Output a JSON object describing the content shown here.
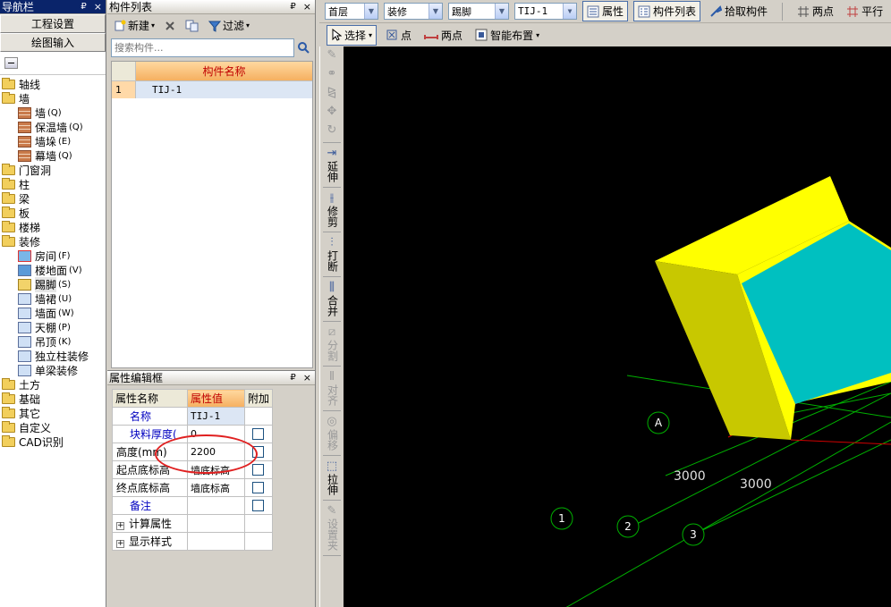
{
  "nav": {
    "title": "导航栏",
    "pin": "₽",
    "close": "×",
    "buttons": [
      "工程设置",
      "绘图输入"
    ],
    "tree": [
      {
        "label": "轴线",
        "level": 0
      },
      {
        "label": "墙",
        "level": 0
      },
      {
        "label": "墙",
        "key": "(Q)",
        "level": 1,
        "icon": "wall-icon"
      },
      {
        "label": "保温墙",
        "key": "(Q)",
        "level": 1,
        "icon": "insulation-wall-icon"
      },
      {
        "label": "墙垛",
        "key": "(E)",
        "level": 1,
        "icon": "wall-pier-icon"
      },
      {
        "label": "幕墙",
        "key": "(Q)",
        "level": 1,
        "icon": "curtain-wall-icon"
      },
      {
        "label": "门窗洞",
        "level": 0
      },
      {
        "label": "柱",
        "level": 0
      },
      {
        "label": "梁",
        "level": 0
      },
      {
        "label": "板",
        "level": 0
      },
      {
        "label": "楼梯",
        "level": 0
      },
      {
        "label": "装修",
        "level": 0
      },
      {
        "label": "房间",
        "key": "(F)",
        "level": 1,
        "icon": "room-icon"
      },
      {
        "label": "楼地面",
        "key": "(V)",
        "level": 1,
        "icon": "floor-icon"
      },
      {
        "label": "踢脚",
        "key": "(S)",
        "level": 1,
        "icon": "skirting-icon",
        "selected": true
      },
      {
        "label": "墙裙",
        "key": "(U)",
        "level": 1,
        "icon": "dado-icon"
      },
      {
        "label": "墙面",
        "key": "(W)",
        "level": 1,
        "icon": "wall-surface-icon"
      },
      {
        "label": "天棚",
        "key": "(P)",
        "level": 1,
        "icon": "ceiling-icon"
      },
      {
        "label": "吊顶",
        "key": "(K)",
        "level": 1,
        "icon": "suspended-ceiling-icon"
      },
      {
        "label": "独立柱装修",
        "key": "",
        "level": 1,
        "icon": "column-finish-icon"
      },
      {
        "label": "单梁装修",
        "key": "",
        "level": 1,
        "icon": "beam-finish-icon"
      },
      {
        "label": "土方",
        "level": 0
      },
      {
        "label": "基础",
        "level": 0
      },
      {
        "label": "其它",
        "level": 0
      },
      {
        "label": "自定义",
        "level": 0
      },
      {
        "label": "CAD识别",
        "level": 0
      }
    ]
  },
  "component_list": {
    "title": "构件列表",
    "pin": "₽",
    "close": "×",
    "new_label": "新建",
    "filter_label": "过滤",
    "search_placeholder": "搜索构件...",
    "column_header": "构件名称",
    "rows": [
      {
        "num": "1",
        "name": "TIJ-1"
      }
    ]
  },
  "property_editor": {
    "title": "属性编辑框",
    "pin": "₽",
    "close": "×",
    "headers": [
      "属性名称",
      "属性值",
      "附加"
    ],
    "rows": [
      {
        "name": "名称",
        "value": "TIJ-1",
        "checkbox": false
      },
      {
        "name": "块料厚度(",
        "value": "0",
        "checkbox": true
      },
      {
        "name": "高度(mm)",
        "value": "2200",
        "checkbox": true
      },
      {
        "name": "起点底标高",
        "value": "墙底标高",
        "checkbox": true
      },
      {
        "name": "终点底标高",
        "value": "墙底标高",
        "checkbox": true
      },
      {
        "name": "备注",
        "value": "",
        "checkbox": true
      }
    ],
    "groups": [
      "计算属性",
      "显示样式"
    ]
  },
  "toolbar_top": {
    "floor": "首层",
    "category": "装修",
    "type": "踢脚",
    "component": "TIJ-1",
    "property_btn": "属性",
    "component_list_btn": "构件列表",
    "pick_btn": "拾取构件",
    "two_point_btn": "两点",
    "parallel_btn": "平行"
  },
  "toolbar_draw": {
    "select_btn": "选择",
    "point_btn": "点",
    "two_point_btn": "两点",
    "smart_layout_btn": "智能布置"
  },
  "vertical_tools": [
    {
      "label": "延伸",
      "enabled": true
    },
    {
      "label": "修剪",
      "enabled": true
    },
    {
      "label": "打断",
      "enabled": true
    },
    {
      "label": "合并",
      "enabled": true
    },
    {
      "label": "分割",
      "enabled": false
    },
    {
      "label": "对齐",
      "enabled": false
    },
    {
      "label": "偏移",
      "enabled": false
    },
    {
      "label": "拉伸",
      "enabled": true
    },
    {
      "label": "设置夹",
      "enabled": false
    }
  ],
  "canvas": {
    "axis_labels": [
      "A",
      "1",
      "2",
      "3"
    ],
    "dimensions": [
      "3000",
      "3000"
    ],
    "colors": {
      "background": "#000000",
      "box_front": "#c8c800",
      "box_top": "#ffff00",
      "box_inner": "#00c0c0",
      "axis": "#00b000",
      "axis_red": "#d00000"
    }
  }
}
